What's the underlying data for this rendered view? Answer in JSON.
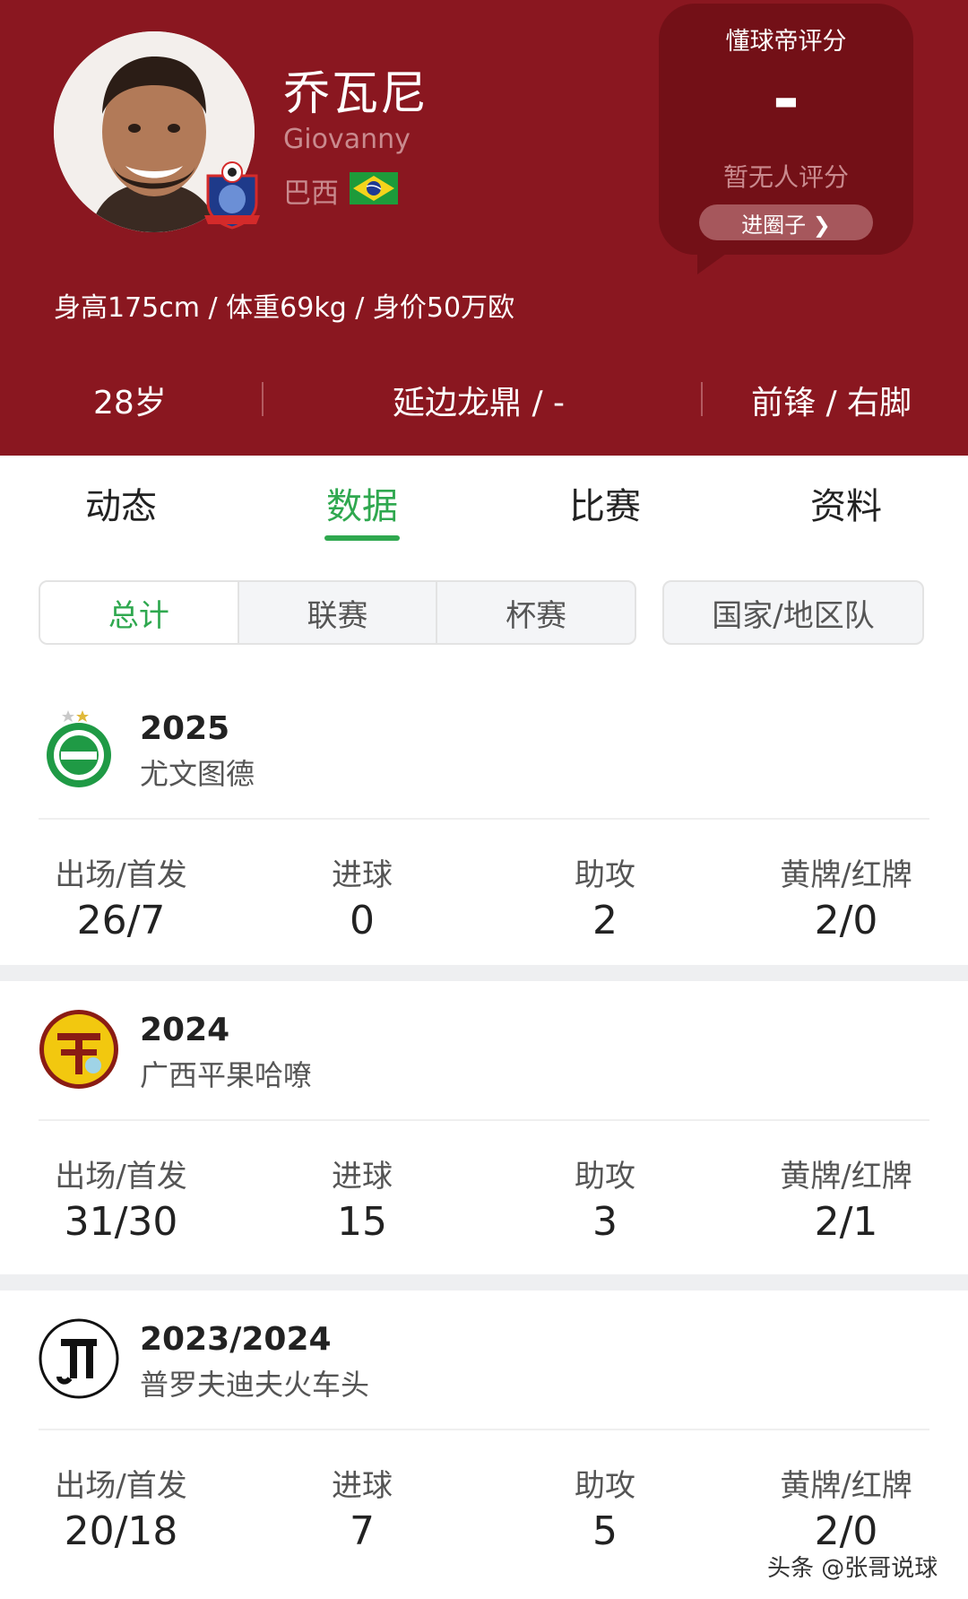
{
  "player": {
    "name_cn": "乔瓦尼",
    "name_en": "Giovanny",
    "nationality": "巴西",
    "body_info": "身高175cm / 体重69kg / 身价50万欧",
    "age": "28岁",
    "club": "延边龙鼎 / -",
    "position": "前锋 / 右脚",
    "avatar_icon": "player-photo",
    "club_badge_icon": "yanbian-longding-badge",
    "flag_icon": "brazil-flag"
  },
  "rating": {
    "title": "懂球帝评分",
    "value": "-",
    "subtitle": "暂无人评分",
    "button": "进圈子 ❯"
  },
  "tabs": [
    {
      "label": "动态"
    },
    {
      "label": "数据"
    },
    {
      "label": "比赛"
    },
    {
      "label": "资料"
    }
  ],
  "active_tab": "数据",
  "filters": {
    "items": [
      {
        "label": "总计"
      },
      {
        "label": "联赛"
      },
      {
        "label": "杯赛"
      }
    ],
    "active": "总计",
    "national": "国家/地区队"
  },
  "stat_labels": {
    "apps": "出场/首发",
    "goals": "进球",
    "assists": "助攻",
    "cards": "黄牌/红牌"
  },
  "seasons": [
    {
      "year": "2025",
      "club": "尤文图德",
      "logo_icon": "juventude-badge",
      "apps": "26/7",
      "goals": "0",
      "assists": "2",
      "cards": "2/0"
    },
    {
      "year": "2024",
      "club": "广西平果哈嘹",
      "logo_icon": "guangxi-pingguo-haliao-badge",
      "apps": "31/30",
      "goals": "15",
      "assists": "3",
      "cards": "2/1"
    },
    {
      "year": "2023/2024",
      "club": "普罗夫迪夫火车头",
      "logo_icon": "lokomotiv-plovdiv-badge",
      "apps": "20/18",
      "goals": "7",
      "assists": "5",
      "cards": "2/0"
    }
  ],
  "watermark": "头条 @张哥说球",
  "colors": {
    "header_bg": "#8a1720",
    "accent_green": "#2fa84f"
  }
}
